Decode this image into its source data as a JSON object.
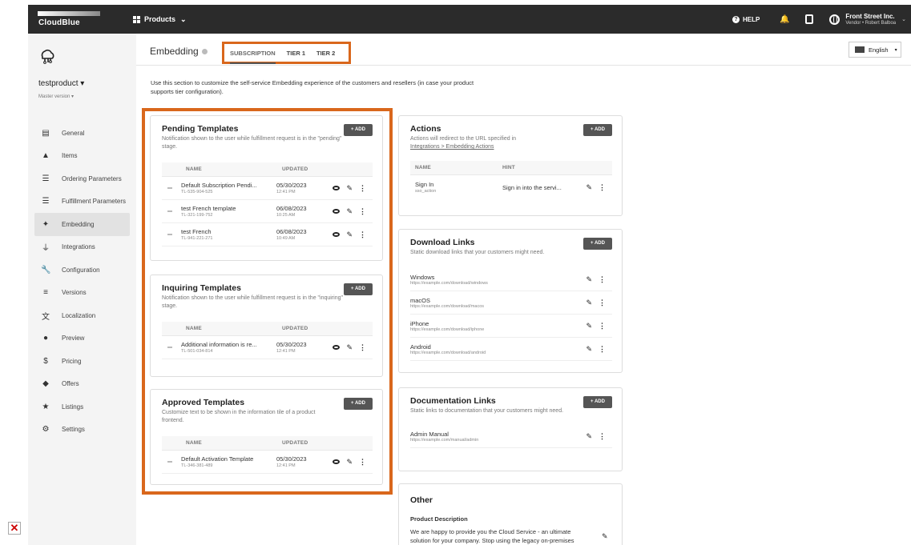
{
  "topbar": {
    "logo_text": "CloudBlue",
    "products_label": "Products",
    "help_label": "HELP",
    "account_name": "Front Street Inc.",
    "account_sub": "Vendor • Robert Balboa"
  },
  "sidebar": {
    "product_name": "testproduct ▾",
    "product_version": "Master version ▾",
    "items": [
      {
        "label": "General",
        "icon": "▤"
      },
      {
        "label": "Items",
        "icon": "▲"
      },
      {
        "label": "Ordering Parameters",
        "icon": "☰"
      },
      {
        "label": "Fulfillment Parameters",
        "icon": "☰"
      },
      {
        "label": "Embedding",
        "icon": "✦"
      },
      {
        "label": "Integrations",
        "icon": "⏚"
      },
      {
        "label": "Configuration",
        "icon": "🔧"
      },
      {
        "label": "Versions",
        "icon": "≡"
      },
      {
        "label": "Localization",
        "icon": "文"
      },
      {
        "label": "Preview",
        "icon": "●"
      },
      {
        "label": "Pricing",
        "icon": "$"
      },
      {
        "label": "Offers",
        "icon": "◆"
      },
      {
        "label": "Listings",
        "icon": "★"
      },
      {
        "label": "Settings",
        "icon": "⚙"
      }
    ]
  },
  "header": {
    "title": "Embedding",
    "tabs": [
      "SUBSCRIPTION",
      "TIER 1",
      "TIER 2"
    ],
    "language": "English"
  },
  "intro": "Use this section to customize the self-service Embedding experience of the customers and resellers (in case your product supports tier configuration).",
  "add_label": "+ ADD",
  "pending": {
    "title": "Pending Templates",
    "desc": "Notification shown to the user while fulfillment request is in the \"pending\" stage.",
    "col_name": "NAME",
    "col_updated": "UPDATED",
    "rows": [
      {
        "name": "Default Subscription Pendi...",
        "id": "TL-535-904-525",
        "date": "05/30/2023",
        "time": "12:41 PM"
      },
      {
        "name": "test French template",
        "id": "TL-321-199-752",
        "date": "06/08/2023",
        "time": "10:25 AM"
      },
      {
        "name": "test French",
        "id": "TL-941-221-271",
        "date": "06/08/2023",
        "time": "10:49 AM"
      }
    ]
  },
  "inquiring": {
    "title": "Inquiring Templates",
    "desc": "Notification shown to the user while fulfillment request is in the \"inquiring\" stage.",
    "col_name": "NAME",
    "col_updated": "UPDATED",
    "rows": [
      {
        "name": "Additional information is re...",
        "id": "TL-501-034-814",
        "date": "05/30/2023",
        "time": "12:41 PM"
      }
    ]
  },
  "approved": {
    "title": "Approved Templates",
    "desc": "Customize text to be shown in the information tile of a product frontend.",
    "col_name": "NAME",
    "col_updated": "UPDATED",
    "rows": [
      {
        "name": "Default Activation Template",
        "id": "TL-346-381-489",
        "date": "05/30/2023",
        "time": "12:41 PM"
      }
    ]
  },
  "actions": {
    "title": "Actions",
    "desc": "Actions will redirect to the URL specified in",
    "link": "Integrations > Embedding Actions",
    "col_name": "NAME",
    "col_hint": "HINT",
    "rows": [
      {
        "name": "Sign In",
        "id": "sso_action",
        "hint": "Sign in into the servi..."
      }
    ]
  },
  "downloads": {
    "title": "Download Links",
    "desc": "Static download links that your customers might need.",
    "rows": [
      {
        "name": "Windows",
        "url": "https://example.com/download/windows"
      },
      {
        "name": "macOS",
        "url": "https://example.com/download/macos"
      },
      {
        "name": "iPhone",
        "url": "https://example.com/download/iphone"
      },
      {
        "name": "Android",
        "url": "https://example.com/download/android"
      }
    ]
  },
  "docs": {
    "title": "Documentation Links",
    "desc": "Static links to documentation that your customers might need.",
    "rows": [
      {
        "name": "Admin Manual",
        "url": "https://example.com/manual/admin"
      }
    ]
  },
  "other": {
    "title": "Other",
    "sub": "Product Description",
    "text": "We are happy to provide you the Cloud Service - an ultimate solution for your company. Stop using the legacy on-premises"
  }
}
